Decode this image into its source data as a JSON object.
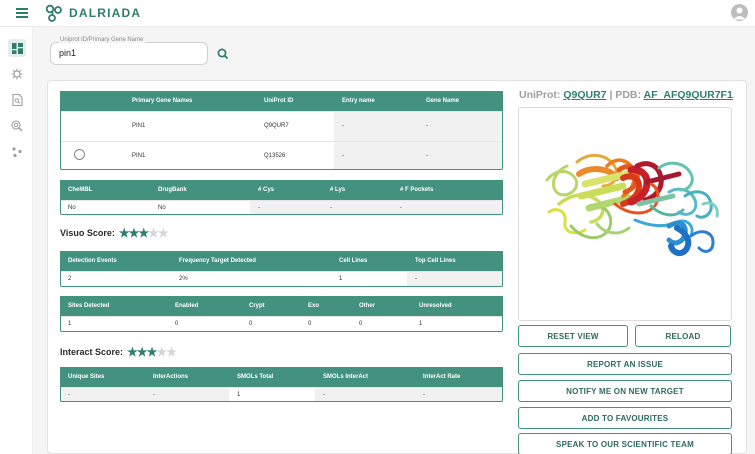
{
  "app": {
    "name": "DALRIADA"
  },
  "search": {
    "label": "Uniprot ID/Primary Gene Name",
    "value": "pin1"
  },
  "gene_table": {
    "headers": [
      "",
      "Primary Gene Names",
      "UniProt ID",
      "Entry name",
      "Gene Name"
    ],
    "rows": [
      {
        "primary": "PIN1",
        "uniprot": "Q9QUR7",
        "entry": "-",
        "gene": "-",
        "radio": false
      },
      {
        "primary": "PIN1",
        "uniprot": "Q13526",
        "entry": "-",
        "gene": "-",
        "radio": true
      }
    ]
  },
  "chem_table": {
    "headers": [
      "CheMBL",
      "DrugBank",
      "# Cys",
      "# Lys",
      "# F Pockets"
    ],
    "row": [
      "No",
      "No",
      "-",
      "-",
      "-"
    ]
  },
  "visuo": {
    "label": "Visuo Score:",
    "score": 3,
    "max": 5
  },
  "detection_table": {
    "headers": [
      "Detection Events",
      "Frequency Target Detected",
      "Cell Lines",
      "Top Cell Lines"
    ],
    "row": [
      "2",
      "2%",
      "1",
      "-"
    ]
  },
  "sites_table": {
    "headers": [
      "Sites Detected",
      "Enabled",
      "Crypt",
      "Exo",
      "Other",
      "Unresolved"
    ],
    "row": [
      "1",
      "0",
      "0",
      "0",
      "0",
      "1"
    ]
  },
  "interact": {
    "label": "Interact Score:",
    "score": 3,
    "max": 5
  },
  "unique_table": {
    "headers": [
      "Unique Sites",
      "InterActions",
      "SMOLs Total",
      "SMOLs InterAct",
      "InterAct Rate"
    ],
    "row": [
      "-",
      "-",
      "1",
      "-",
      "-"
    ]
  },
  "structure": {
    "uniprot_label": "UniProt:",
    "uniprot_id": "Q9QUR7",
    "separator": "|",
    "pdb_label": "PDB:",
    "pdb_id": "AF_AFQ9QUR7F1"
  },
  "buttons": {
    "reset_view": "RESET VIEW",
    "reload": "RELOAD",
    "report_issue": "REPORT AN ISSUE",
    "notify": "NOTIFY ME ON NEW TARGET",
    "favourites": "ADD TO FAVOURITES",
    "speak": "SPEAK TO OUR SCIENTIFIC TEAM"
  },
  "colors": {
    "accent": "#43917f",
    "brand": "#2e7d6f",
    "star_off": "#d6d6d6"
  },
  "icons": {
    "menu": "hamburger-icon",
    "logo": "molecule-logo-icon",
    "avatar": "user-avatar-icon",
    "search": "search-icon",
    "sidebar": [
      "dashboard-icon",
      "virus-icon",
      "document-search-icon",
      "target-search-icon",
      "molecule-icon"
    ]
  }
}
